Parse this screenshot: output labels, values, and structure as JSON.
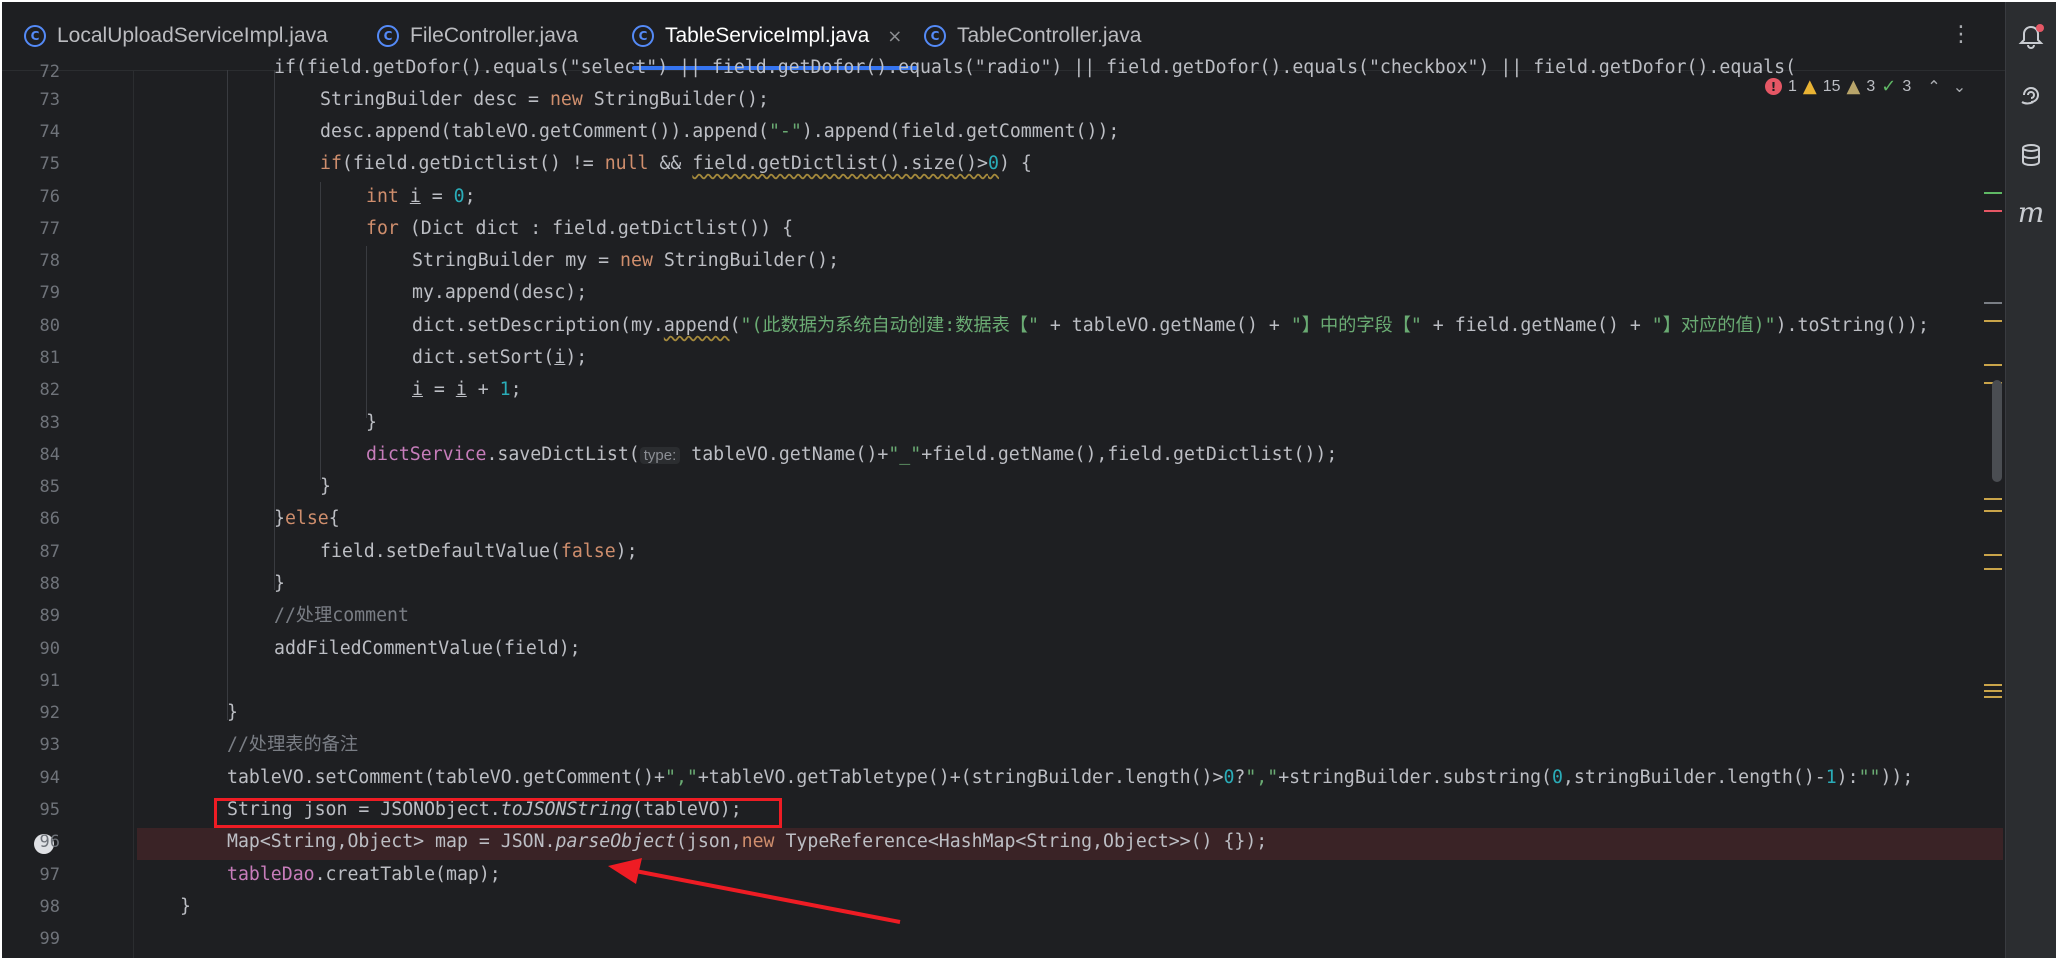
{
  "tabs": [
    {
      "label": "LocalUploadServiceImpl.java",
      "active": false
    },
    {
      "label": "FileController.java",
      "active": false
    },
    {
      "label": "TableServiceImpl.java",
      "active": true
    },
    {
      "label": "TableController.java",
      "active": false
    }
  ],
  "tab_close_glyph": "×",
  "more_glyph": "⋮",
  "inspections": {
    "errors": "1",
    "warnings": "15",
    "weak_warnings": "3",
    "typos": "3"
  },
  "tool_icons": [
    "notifications-icon",
    "ai-assistant-icon",
    "database-icon",
    "maven-icon"
  ],
  "maven_letter": "m",
  "line_numbers": [
    "72",
    "73",
    "74",
    "75",
    "76",
    "77",
    "78",
    "79",
    "80",
    "81",
    "82",
    "83",
    "84",
    "85",
    "86",
    "87",
    "88",
    "89",
    "90",
    "91",
    "92",
    "93",
    "94",
    "95",
    "96",
    "97",
    "98",
    "99"
  ],
  "code": {
    "l72": "if(field.getDofor().equals(\"select\") || field.getDofor().equals(\"radio\") || field.getDofor().equals(\"checkbox\") || field.getDofor().equals(",
    "l73a": "StringBuilder desc = ",
    "l73kw": "new",
    "l73b": " StringBuilder();",
    "l74a": "desc.append(tableVO.getComment()).append(",
    "l74s": "\"-\"",
    "l74b": ").append(field.getComment());",
    "l75kw": "if",
    "l75a": "(field.getDictlist() != ",
    "l75kw2": "null",
    "l75b": " && ",
    "l75u": "field.getDictlist().size()>",
    "l75n": "0",
    "l75c": ") {",
    "l76kw": "int",
    "l76a": " ",
    "l76v": "i",
    "l76b": " = ",
    "l76n": "0",
    "l76c": ";",
    "l77kw": "for",
    "l77a": " (Dict dict : field.getDictlist()) {",
    "l78a": "StringBuilder my = ",
    "l78kw": "new",
    "l78b": " StringBuilder();",
    "l79a": "my.append(desc);",
    "l80a": "dict.setDescription(my.",
    "l80u": "append",
    "l80b": "(",
    "l80s1": "\"(此数据为系统自动创建:数据表【\"",
    "l80c": " + tableVO.getName() + ",
    "l80s2": "\"】中的字段【\"",
    "l80d": " + field.getName() + ",
    "l80s3": "\"】对应的值)\"",
    "l80e": ").toString());",
    "l81a": "dict.setSort(",
    "l81v": "i",
    "l81b": ");",
    "l82v1": "i",
    "l82a": " = ",
    "l82v2": "i",
    "l82b": " + ",
    "l82n": "1",
    "l82c": ";",
    "l83a": "}",
    "l84f": "dictService",
    "l84a": ".saveDictList(",
    "l84hint": "type:",
    "l84b": " tableVO.getName()+",
    "l84s": "\"_\"",
    "l84c": "+field.getName(),field.getDictlist());",
    "l85a": "}",
    "l86a": "}",
    "l86kw": "else",
    "l86b": "{",
    "l87a": "field.setDefaultValue(",
    "l87kw": "false",
    "l87b": ");",
    "l88a": "}",
    "l89c": "//处理comment",
    "l90a": "addFiledCommentValue(field);",
    "l92a": "}",
    "l93c": "//处理表的备注",
    "l94a": "tableVO.setComment(tableVO.getComment()+",
    "l94s1": "\",\"",
    "l94b": "+tableVO.getTabletype()+(stringBuilder.length()>",
    "l94n1": "0",
    "l94c": "?",
    "l94s2": "\",\"",
    "l94d": "+stringBuilder.substring(",
    "l94n2": "0",
    "l94e": ",stringBuilder.length()-",
    "l94n3": "1",
    "l94f": "):",
    "l94s3": "\"\"",
    "l94g": "));",
    "l95a": "String json = JSONObject.",
    "l95i": "toJSONString",
    "l95b": "(tableVO);",
    "l96a": "Map<String,Object> map = JSON.",
    "l96i": "parseObject",
    "l96b": "(json,",
    "l96kw": "new",
    "l96c": " TypeReference<HashMap<String,Object>>() {});",
    "l97f": "tableDao",
    "l97a": ".creatTable(map);",
    "l98a": "}"
  }
}
